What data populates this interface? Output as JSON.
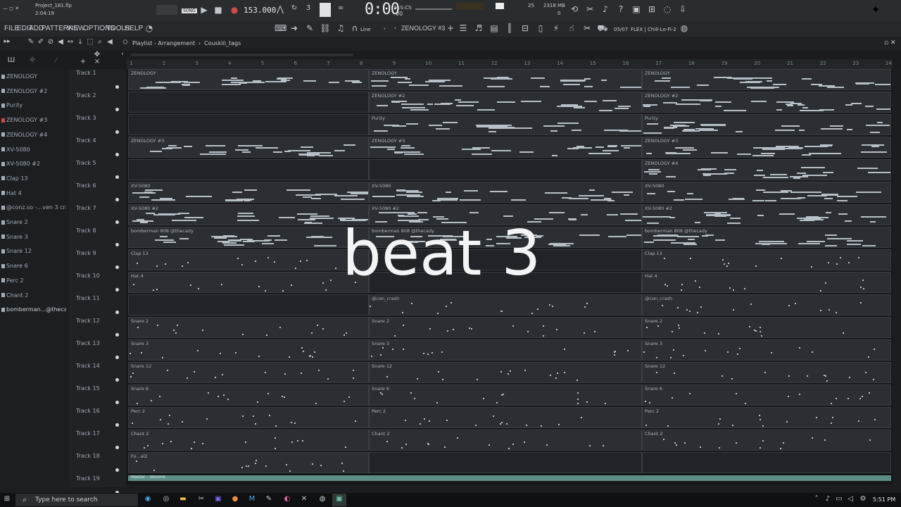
{
  "window": {
    "project_file": "Project_181.flp",
    "elapsed": "2:04:19",
    "bpm": "153.000",
    "song_mode_label": "SONG",
    "time_display": "0:00",
    "time_display_sub": "00",
    "time_unit": "M:S:CS",
    "memory": "2318 MB",
    "cpu_count": "25",
    "voices": "0"
  },
  "menu": {
    "items": [
      "FILE",
      "EDIT",
      "ADD",
      "PATTERNS",
      "VIEW",
      "OPTIONS",
      "TOOLS",
      "HELP"
    ],
    "current_pattern": "ZENOLOGY #3",
    "snap_mode": "Line",
    "news_count": "05/07",
    "news_text": "FLEX | Chill-Lo-Fi-2"
  },
  "playlist": {
    "breadcrumb_root": "Playlist - Arrangement",
    "breadcrumb_sep": "›",
    "breadcrumb_pattern": "Couskiii_tags"
  },
  "channels": [
    {
      "label": "ZENOLOGY",
      "red": false
    },
    {
      "label": "ZENOLOGY #2",
      "red": false
    },
    {
      "label": "Purity",
      "red": false
    },
    {
      "label": "ZENOLOGY #3",
      "red": true
    },
    {
      "label": "ZENOLOGY #4",
      "red": false
    },
    {
      "label": "XV-5080",
      "red": false
    },
    {
      "label": "XV-5080 #2",
      "red": false
    },
    {
      "label": "Clap 13",
      "red": false
    },
    {
      "label": "Hat 4",
      "red": false
    },
    {
      "label": "@conz.so -...ven 3 crash",
      "red": false
    },
    {
      "label": "Snare 2",
      "red": false
    },
    {
      "label": "Snare 3",
      "red": false
    },
    {
      "label": "Snare 12",
      "red": false
    },
    {
      "label": "Snare 6",
      "red": false
    },
    {
      "label": "Perc 2",
      "red": false
    },
    {
      "label": "Chant 2",
      "red": false
    },
    {
      "label": "bomberman...@thecady",
      "red": false
    }
  ],
  "tracks": [
    "Track 1",
    "Track 2",
    "Track 3",
    "Track 4",
    "Track 5",
    "Track 6",
    "Track 7",
    "Track 8",
    "Track 9",
    "Track 10",
    "Track 11",
    "Track 12",
    "Track 13",
    "Track 14",
    "Track 15",
    "Track 16",
    "Track 17",
    "Track 18",
    "Track 19"
  ],
  "ruler_bars": [
    "1",
    "2",
    "3",
    "4",
    "5",
    "6",
    "7",
    "8",
    "9",
    "10",
    "11",
    "12",
    "13",
    "14",
    "15",
    "16",
    "17",
    "18",
    "19",
    "20",
    "21",
    "22",
    "23",
    "24"
  ],
  "clip_rows": [
    [
      "ZENOLOGY",
      "ZENOLOGY",
      "ZENOLOGY"
    ],
    [
      "",
      "ZENOLOGY #2",
      "ZENOLOGY #2"
    ],
    [
      "",
      "Purity",
      "Purity"
    ],
    [
      "ZENOLOGY #3",
      "ZENOLOGY #3",
      "ZENOLOGY #3"
    ],
    [
      "",
      "",
      "ZENOLOGY #4"
    ],
    [
      "XV-5080",
      "XV-5080",
      "XV-5080"
    ],
    [
      "XV-5080 #2",
      "XV-5080 #2",
      "XV-5080 #2"
    ],
    [
      "bomberman 808 @thecady",
      "bomberman 808 @thecady",
      "bomberman 808 @thecady"
    ],
    [
      "Clap 13",
      "",
      "Clap 13"
    ],
    [
      "Hat 4",
      "",
      "Hat 4"
    ],
    [
      "",
      "@con_crash",
      "@con_crash"
    ],
    [
      "Snare 2",
      "Snare 2",
      "Snare 2"
    ],
    [
      "Snare 3",
      "Snare 3",
      "Snare 3"
    ],
    [
      "Snare 12",
      "Snare 12",
      "Snare 12"
    ],
    [
      "Snare 6",
      "Snare 6",
      "Snare 6"
    ],
    [
      "Perc 2",
      "Perc 2",
      "Perc 2"
    ],
    [
      "Chant 2",
      "Chant 2",
      "Chant 2"
    ],
    [
      "Fo...al2",
      "",
      ""
    ]
  ],
  "master_volume_label": "Master - Volume",
  "overlay_text": "beat 3",
  "taskbar": {
    "search_placeholder": "Type here to search",
    "clock": "5:51 PM"
  },
  "colors": {
    "accent_teal": "#5d8e86",
    "record_red": "#d04848",
    "background": "#15171a"
  }
}
